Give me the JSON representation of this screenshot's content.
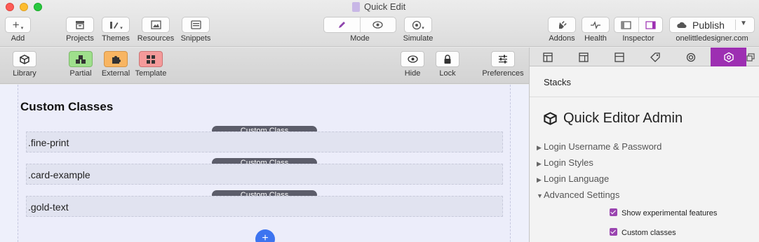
{
  "window": {
    "title": "Quick Edit"
  },
  "toolbar": {
    "add_label": "Add",
    "projects_label": "Projects",
    "themes_label": "Themes",
    "resources_label": "Resources",
    "snippets_label": "Snippets",
    "mode_label": "Mode",
    "simulate_label": "Simulate",
    "addons_label": "Addons",
    "health_label": "Health",
    "inspector_label": "Inspector",
    "publish_button": "Publish",
    "publish_site": "onelittledesigner.com"
  },
  "subbar": {
    "library_label": "Library",
    "partial_label": "Partial",
    "external_label": "External",
    "template_label": "Template",
    "hide_label": "Hide",
    "lock_label": "Lock",
    "preferences_label": "Preferences"
  },
  "canvas": {
    "heading": "Custom Classes",
    "badge_label": "Custom Class",
    "rows": [
      {
        "text": ".fine-print"
      },
      {
        "text": ".card-example"
      },
      {
        "text": ".gold-text"
      }
    ],
    "add_button": "+"
  },
  "inspector": {
    "section_heading": "Stacks",
    "title": "Quick Editor Admin",
    "groups": [
      {
        "label": "Login Username & Password",
        "expanded": false
      },
      {
        "label": "Login Styles",
        "expanded": false
      },
      {
        "label": "Login Language",
        "expanded": false
      },
      {
        "label": "Advanced Settings",
        "expanded": true
      }
    ],
    "checkboxes": [
      {
        "label": "Show experimental features",
        "checked": true
      },
      {
        "label": "Custom classes",
        "checked": true
      }
    ],
    "active_tab_color": "#9d2fb2"
  },
  "colors": {
    "accent": "#9d2fb2",
    "add_button": "#3d74f0",
    "badge": "#5c5d6a"
  }
}
